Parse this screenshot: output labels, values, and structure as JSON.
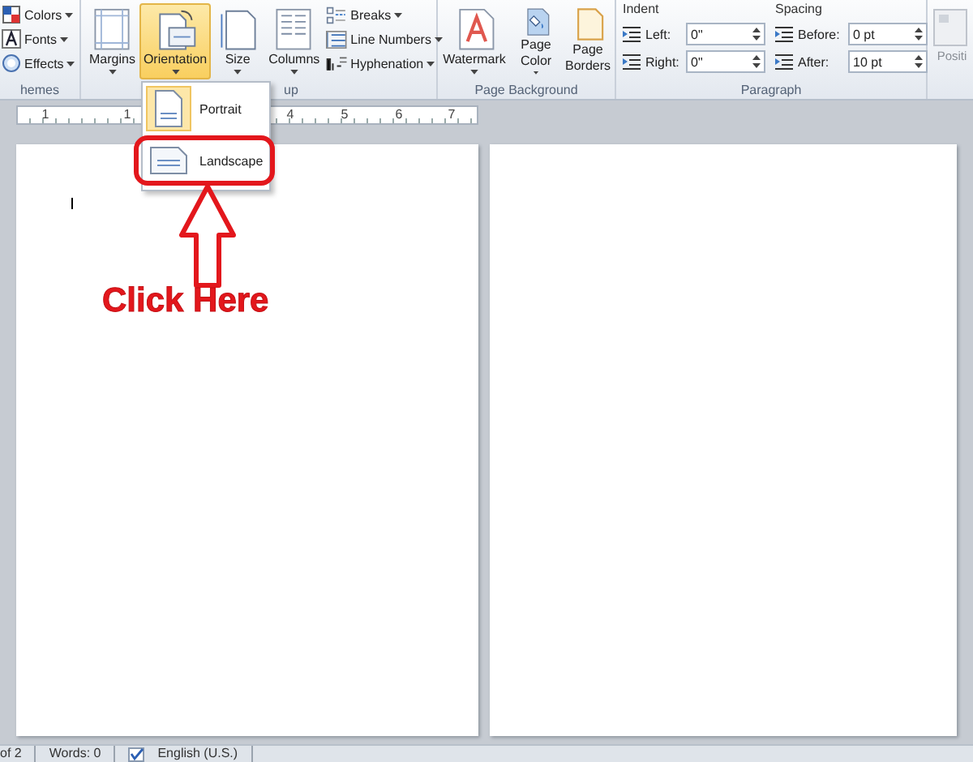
{
  "ribbon": {
    "themes_group": {
      "label": "hemes",
      "items": [
        {
          "label": "Colors"
        },
        {
          "label": "Fonts"
        },
        {
          "label": "Effects"
        }
      ]
    },
    "page_setup_group": {
      "label": "up",
      "buttons": [
        {
          "label": "Margins",
          "selected": false
        },
        {
          "label": "Orientation",
          "selected": true
        },
        {
          "label": "Size",
          "selected": false
        },
        {
          "label": "Columns",
          "selected": false
        }
      ],
      "small_buttons": [
        {
          "label": "Breaks"
        },
        {
          "label": "Line Numbers"
        },
        {
          "label": "Hyphenation"
        }
      ]
    },
    "page_background_group": {
      "label": "Page Background",
      "buttons": [
        {
          "label": "Watermark"
        },
        {
          "label": "Page Color"
        },
        {
          "label": "Page Borders"
        }
      ]
    },
    "paragraph_group": {
      "label": "Paragraph",
      "indent": {
        "title": "Indent",
        "fields": [
          {
            "label": "Left:",
            "value": "0\""
          },
          {
            "label": "Right:",
            "value": "0\""
          }
        ]
      },
      "spacing": {
        "title": "Spacing",
        "fields": [
          {
            "label": "Before:",
            "value": "0 pt"
          },
          {
            "label": "After:",
            "value": "10 pt"
          }
        ]
      }
    },
    "position_group": {
      "label": "Positi"
    }
  },
  "ruler": {
    "numbers": [
      "1",
      "1",
      "4",
      "5",
      "6",
      "7"
    ]
  },
  "orientation_menu": {
    "items": [
      {
        "label": "Portrait",
        "selected": true
      },
      {
        "label": "Landscape",
        "selected": false
      }
    ]
  },
  "annotation": {
    "text": "Click Here"
  },
  "status_bar": {
    "items": [
      "of 2",
      "Words: 0",
      "English (U.S.)"
    ]
  }
}
